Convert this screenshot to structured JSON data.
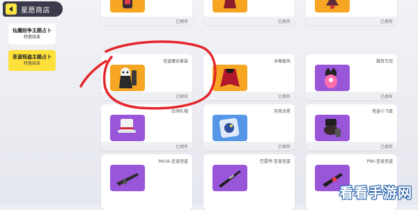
{
  "header": {
    "title": "星愿商店",
    "back_icon": "back-arrow-icon",
    "accent": "#fde445"
  },
  "menu": [
    {
      "title": "仙魔纷争主题占卜",
      "subtitle": "特惠结束",
      "selected": false
    },
    {
      "title": "圣诞怪盗主题占卜",
      "subtitle": "特惠结束",
      "selected": true
    }
  ],
  "cards": [
    {
      "name": "",
      "status": "已拥有",
      "color": "#f6a623"
    },
    {
      "name": "",
      "status": "已拥有",
      "color": "#f6a623"
    },
    {
      "name": "",
      "status": "已拥有",
      "color": "#f6a623"
    },
    {
      "name": "怪盗魔女套装",
      "status": "已拥有",
      "color": "#f6a623"
    },
    {
      "name": "冰莓披风",
      "status": "已拥有",
      "color": "#f6a623"
    },
    {
      "name": "猫耳王冠",
      "status": "已拥有",
      "color": "#9a56d9"
    },
    {
      "name": "白鸽礼帽",
      "status": "已拥有",
      "color": "#9a56d9"
    },
    {
      "name": "月夜流星",
      "status": "已拥有",
      "color": "#5596e6"
    },
    {
      "name": "怪盗小飞鼠",
      "status": "已拥有",
      "color": "#9a56d9"
    },
    {
      "name": "M416-圣诞怪盗",
      "status": "",
      "color": "#9a56d9"
    },
    {
      "name": "巴雷特-圣诞怪盗",
      "status": "",
      "color": "#9a56d9"
    },
    {
      "name": "P90-圣诞怪盗",
      "status": "",
      "color": "#9a56d9"
    }
  ],
  "annotation_color": "#e4262a",
  "watermark": "看看手游网"
}
